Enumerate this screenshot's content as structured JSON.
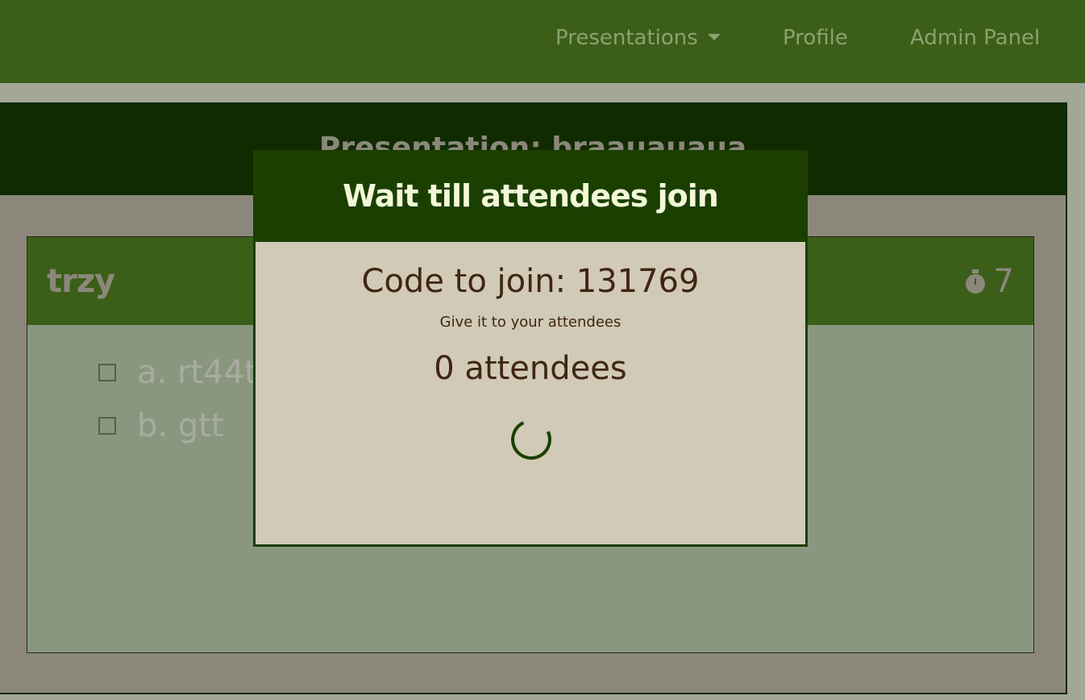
{
  "navbar": {
    "presentations_label": "Presentations",
    "profile_label": "Profile",
    "admin_label": "Admin Panel"
  },
  "presentation": {
    "title": "Presentation: braauauaua"
  },
  "question": {
    "title": "trzy",
    "timer_value": "7",
    "answers": [
      {
        "label": "a. rt44t"
      },
      {
        "label": "b. gtt"
      }
    ]
  },
  "modal": {
    "title": "Wait till attendees join",
    "code_text": "Code to join: 131769",
    "hint": "Give it to your attendees",
    "attendees_text": "0 attendees"
  },
  "colors": {
    "navbar": "#3b5f18",
    "modal_header": "#1b3f00",
    "modal_body": "#d1cab6",
    "text_brown": "#3f2612"
  },
  "icons": {
    "presentations_caret": "caret-down-icon",
    "timer": "stopwatch-icon",
    "loading": "spinner-icon"
  }
}
